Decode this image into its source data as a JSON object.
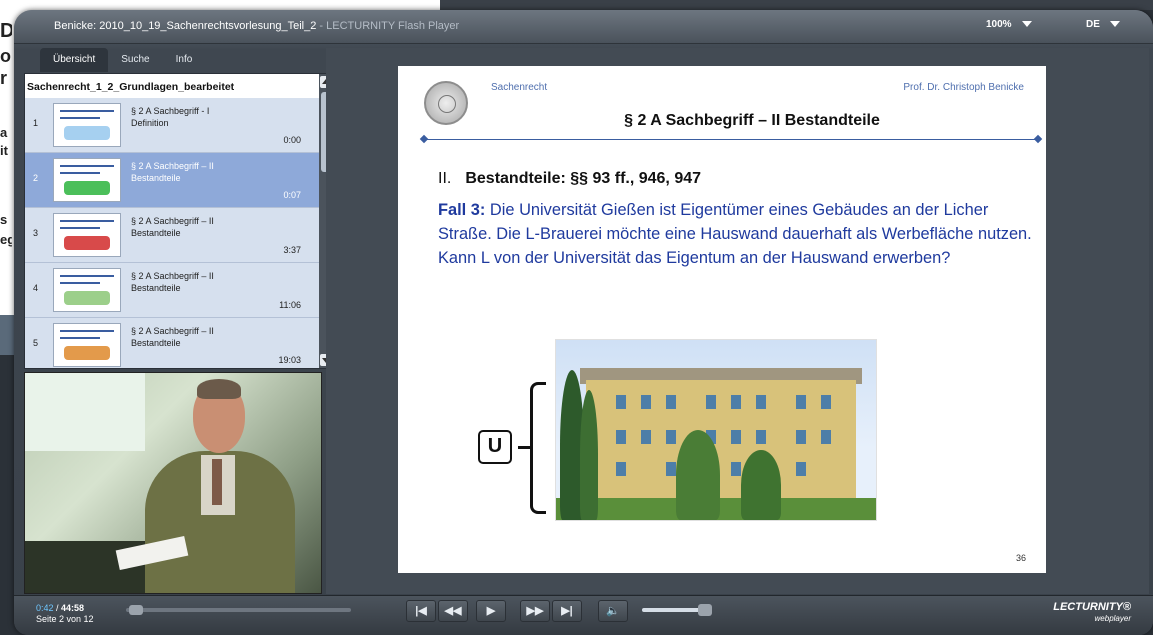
{
  "background": {
    "fragments": [
      "Ds",
      "o",
      "r",
      "a",
      "it",
      "s",
      "eg"
    ]
  },
  "window": {
    "title": "Benicke: 2010_10_19_Sachenrechtsvorlesung_Teil_2",
    "app_name": " - LECTURNITY Flash Player",
    "zoom": "100%",
    "language": "DE"
  },
  "tabs": [
    "Übersicht",
    "Suche",
    "Info"
  ],
  "toc": {
    "heading": "Sachenrecht_1_2_Grundlagen_bearbeitet",
    "items": [
      {
        "num": "1",
        "line1": "§ 2 A Sachbegriff - I",
        "line2": "Definition",
        "time": "0:00"
      },
      {
        "num": "2",
        "line1": "§ 2 A Sachbegriff – II",
        "line2": "Bestandteile",
        "time": "0:07"
      },
      {
        "num": "3",
        "line1": "§ 2 A Sachbegriff – II",
        "line2": "Bestandteile",
        "time": "3:37"
      },
      {
        "num": "4",
        "line1": "§ 2 A Sachbegriff – II",
        "line2": "Bestandteile",
        "time": "11:06"
      },
      {
        "num": "5",
        "line1": "§ 2 A Sachbegriff – II",
        "line2": "Bestandteile",
        "time": "19:03"
      }
    ]
  },
  "slide": {
    "course": "Sachenrecht",
    "author": "Prof. Dr. Christoph Benicke",
    "title": "§ 2 A Sachbegriff – II Bestandteile",
    "heading_num": "II.",
    "heading_text": "Bestandteile: §§ 93 ff., 946, 947",
    "case_label": "Fall 3:",
    "case_text": " Die Universität Gießen ist Eigentümer eines Gebäudes an der Licher Straße. Die L-Brauerei möchte eine Hauswand dauerhaft als Werbefläche nutzen. Kann L von der Universität das Eigentum an der Hauswand erwerben?",
    "box_label": "U",
    "page_number": "36"
  },
  "playback": {
    "current_time": "0:42",
    "separator": " / ",
    "total_time": "44:58",
    "page_info": "Seite 2 von 12",
    "progress_fraction": 0.016,
    "volume_fraction": 1.0
  },
  "controls": {
    "first_label": "|◀",
    "rewind_label": "◀◀",
    "play_label": "▶",
    "forward_label": "▶▶",
    "last_label": "▶|",
    "volume_label": "🔈"
  },
  "brand": {
    "name": "LECTURNITY®",
    "sub": "webplayer"
  },
  "colors": {
    "accent_blue": "#1f3a9e",
    "selected_item": "#8ea9d9",
    "time_blue": "#6fc7ff"
  }
}
